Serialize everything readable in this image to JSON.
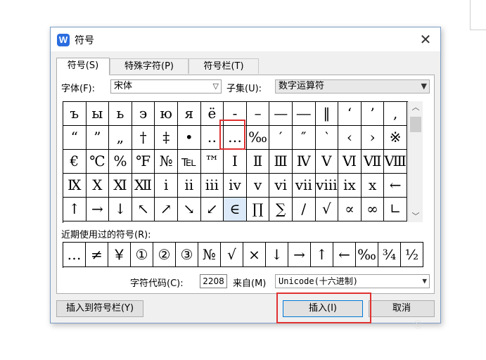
{
  "dialog": {
    "title": "符号",
    "app_icon_letter": "W",
    "close_glyph": "✕"
  },
  "tabs": [
    {
      "label": "符号(S)"
    },
    {
      "label": "特殊字符(P)"
    },
    {
      "label": "符号栏(T)"
    }
  ],
  "font": {
    "label": "字体(F):",
    "value": "宋体"
  },
  "subset": {
    "label": "子集(U):",
    "value": "数字运算符"
  },
  "symbol_rows": [
    [
      "ъ",
      "ы",
      "ь",
      "э",
      "ю",
      "я",
      "ё",
      "-",
      "–",
      "—",
      "―",
      "‖",
      "‘",
      "’",
      ","
    ],
    [
      "“",
      "”",
      "„",
      "†",
      "‡",
      "•",
      "‥",
      "…",
      "‰",
      "′",
      "″",
      "‵",
      "‹",
      "›",
      "※"
    ],
    [
      "€",
      "℃",
      "%",
      "℉",
      "№",
      "℡",
      "™",
      "Ⅰ",
      "Ⅱ",
      "Ⅲ",
      "Ⅳ",
      "Ⅴ",
      "Ⅵ",
      "Ⅶ",
      "Ⅷ"
    ],
    [
      "Ⅸ",
      "Ⅹ",
      "Ⅺ",
      "Ⅻ",
      "ⅰ",
      "ⅱ",
      "ⅲ",
      "ⅳ",
      "ⅴ",
      "ⅵ",
      "ⅶ",
      "ⅷ",
      "ⅸ",
      "ⅹ",
      "←"
    ],
    [
      "↑",
      "→",
      "↓",
      "↖",
      "↗",
      "↘",
      "↙",
      "∈",
      "∏",
      "∑",
      "∕",
      "√",
      "∝",
      "∞",
      "∟"
    ]
  ],
  "recent": {
    "label": "近期使用过的符号(R):",
    "items": [
      "…",
      "≠",
      "￥",
      "①",
      "②",
      "③",
      "№",
      "√",
      "×",
      "↓",
      "→",
      "↑",
      "←",
      "‰",
      "¾",
      "½"
    ]
  },
  "char_code": {
    "label": "字符代码(C):",
    "value": "2208"
  },
  "from": {
    "label": "来自(M)",
    "value": "Unicode(十六进制)"
  },
  "buttons": {
    "insert_to_bar": "插入到符号栏(Y)",
    "insert": "插入(I)",
    "cancel": "取消"
  },
  "colors": {
    "highlight": "#e03030",
    "accent": "#0078d7",
    "selected_cell": "#dce9f8"
  }
}
